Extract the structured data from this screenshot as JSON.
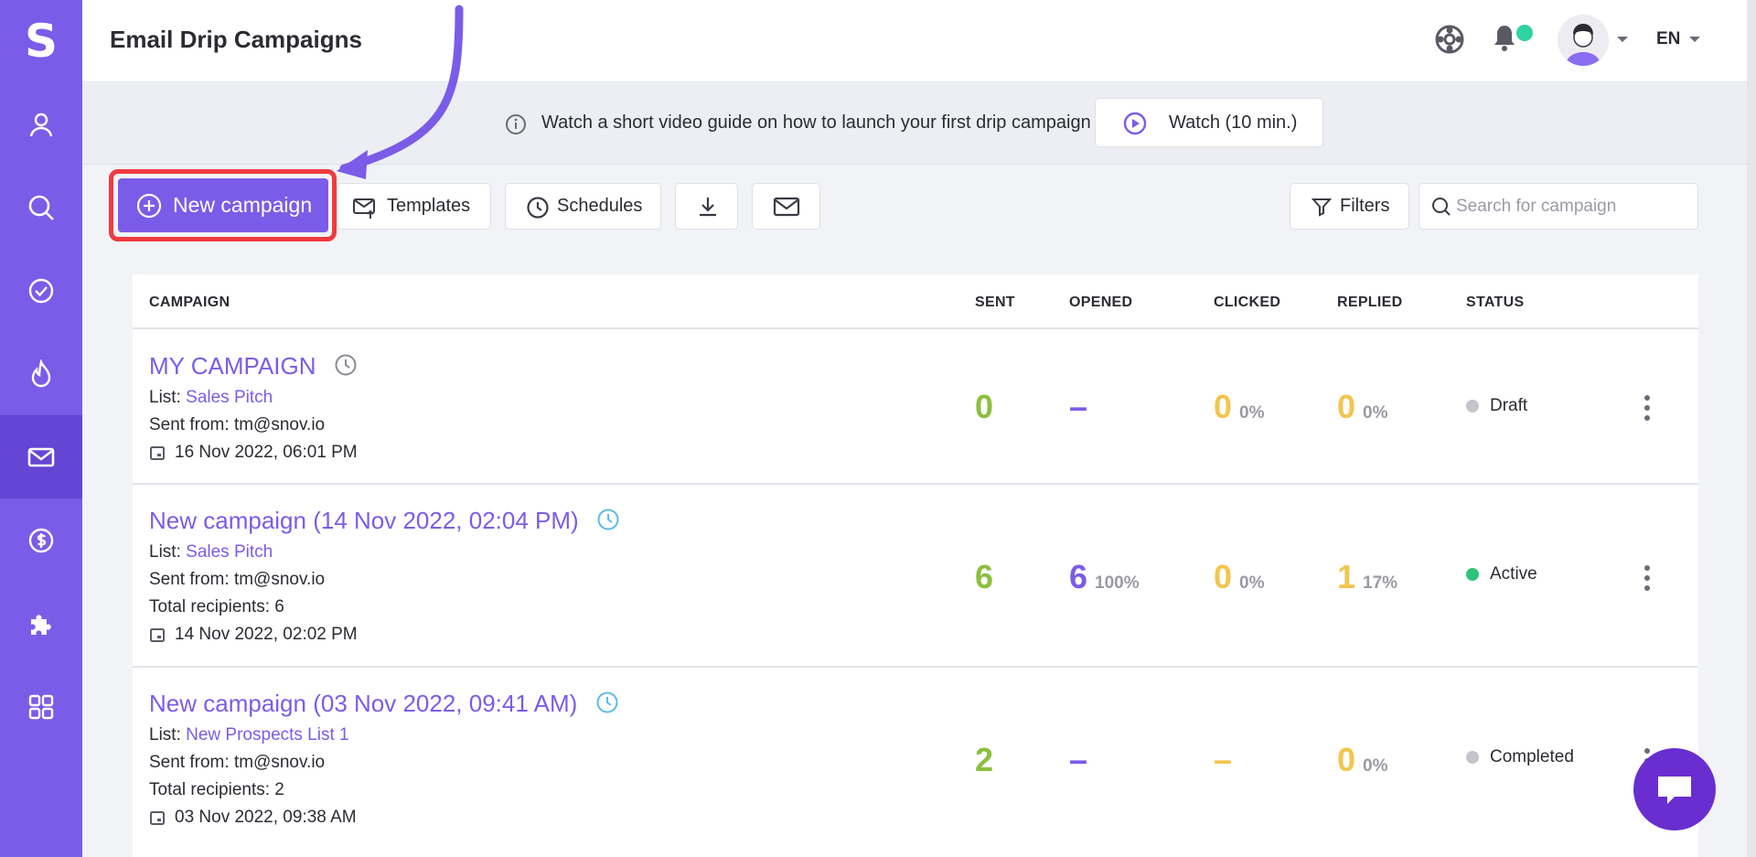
{
  "app": {
    "logo_letter": "S",
    "title": "Email Drip Campaigns",
    "language": "EN"
  },
  "sidebar": {
    "items": [
      {
        "name": "contacts",
        "icon": "user-icon"
      },
      {
        "name": "search",
        "icon": "search-icon"
      },
      {
        "name": "verify",
        "icon": "check-circle-icon"
      },
      {
        "name": "warmup",
        "icon": "flame-icon"
      },
      {
        "name": "campaigns",
        "icon": "envelope-icon",
        "active": true
      },
      {
        "name": "billing",
        "icon": "dollar-icon"
      },
      {
        "name": "integrations",
        "icon": "puzzle-icon"
      },
      {
        "name": "apps",
        "icon": "grid-icon"
      }
    ]
  },
  "banner": {
    "text": "Watch a short video guide on how to launch your first drip campaign",
    "watch_label": "Watch (10 min.)"
  },
  "toolbar": {
    "new_campaign": "New campaign",
    "templates": "Templates",
    "schedules": "Schedules",
    "filters": "Filters",
    "search_placeholder": "Search for campaign"
  },
  "table": {
    "headers": {
      "campaign": "CAMPAIGN",
      "sent": "SENT",
      "opened": "OPENED",
      "clicked": "CLICKED",
      "replied": "REPLIED",
      "status": "STATUS"
    },
    "rows": [
      {
        "name": "MY CAMPAIGN",
        "list_label": "List:",
        "list": "Sales Pitch",
        "sent_from_label": "Sent from:",
        "sent_from": "tm@snov.io",
        "date": "16 Nov 2022, 06:01 PM",
        "sent": "0",
        "opened": "–",
        "opened_pct": "",
        "clicked": "0",
        "clicked_pct": "0%",
        "replied": "0",
        "replied_pct": "0%",
        "status": "Draft",
        "status_color": "#c4c4cc"
      },
      {
        "name": "New campaign (14 Nov 2022, 02:04 PM)",
        "list_label": "List:",
        "list": "Sales Pitch",
        "sent_from_label": "Sent from:",
        "sent_from": "tm@snov.io",
        "recipients_label": "Total recipients:",
        "recipients": "6",
        "date": "14 Nov 2022, 02:02 PM",
        "sent": "6",
        "opened": "6",
        "opened_pct": "100%",
        "clicked": "0",
        "clicked_pct": "0%",
        "replied": "1",
        "replied_pct": "17%",
        "status": "Active",
        "status_color": "#2ec47a"
      },
      {
        "name": "New campaign (03 Nov 2022, 09:41 AM)",
        "list_label": "List:",
        "list": "New Prospects List 1",
        "sent_from_label": "Sent from:",
        "sent_from": "tm@snov.io",
        "recipients_label": "Total recipients:",
        "recipients": "2",
        "date": "03 Nov 2022, 09:38 AM",
        "sent": "2",
        "opened": "–",
        "opened_pct": "",
        "clicked": "–",
        "clicked_pct": "",
        "replied": "0",
        "replied_pct": "0%",
        "status": "Completed",
        "status_color": "#c4c4cc"
      }
    ]
  },
  "colors": {
    "accent": "#7b5ce8",
    "highlight": "#f03a3f",
    "notification": "#2ed3a2"
  }
}
